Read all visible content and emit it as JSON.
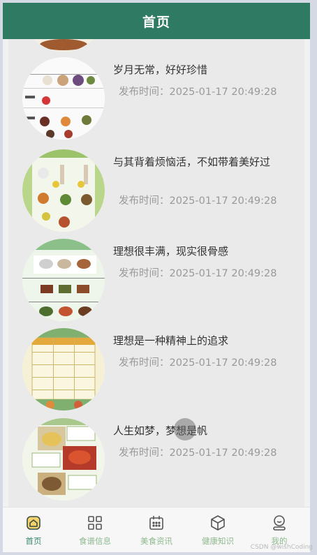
{
  "header": {
    "title": "首页"
  },
  "items": [
    {
      "title": "岁月无常，好好珍惜",
      "time": "发布时间：2025-01-17 20:49:28"
    },
    {
      "title": "与其背着烦恼活，不如带着美好过",
      "time": "发布时间：2025-01-17 20:49:28"
    },
    {
      "title": "理想很丰满，现实很骨感",
      "time": "发布时间：2025-01-17 20:49:28"
    },
    {
      "title": "理想是一种精神上的追求",
      "time": "发布时间：2025-01-17 20:49:28"
    },
    {
      "title": "人生如梦，梦想是帆",
      "time": "发布时间：2025-01-17 20:49:28"
    }
  ],
  "tabs": [
    {
      "label": "首页",
      "icon": "home-icon",
      "active": true
    },
    {
      "label": "食谱信息",
      "icon": "grid-icon",
      "active": false
    },
    {
      "label": "美食资讯",
      "icon": "calendar-icon",
      "active": false
    },
    {
      "label": "健康知识",
      "icon": "cube-icon",
      "active": false
    },
    {
      "label": "我的",
      "icon": "user-icon",
      "active": false
    }
  ],
  "watermark": "CSDN @wishCoding",
  "colors": {
    "header": "#2f7a62",
    "active_tab": "#3d8b6e",
    "inactive_tab": "#8fb98f"
  }
}
